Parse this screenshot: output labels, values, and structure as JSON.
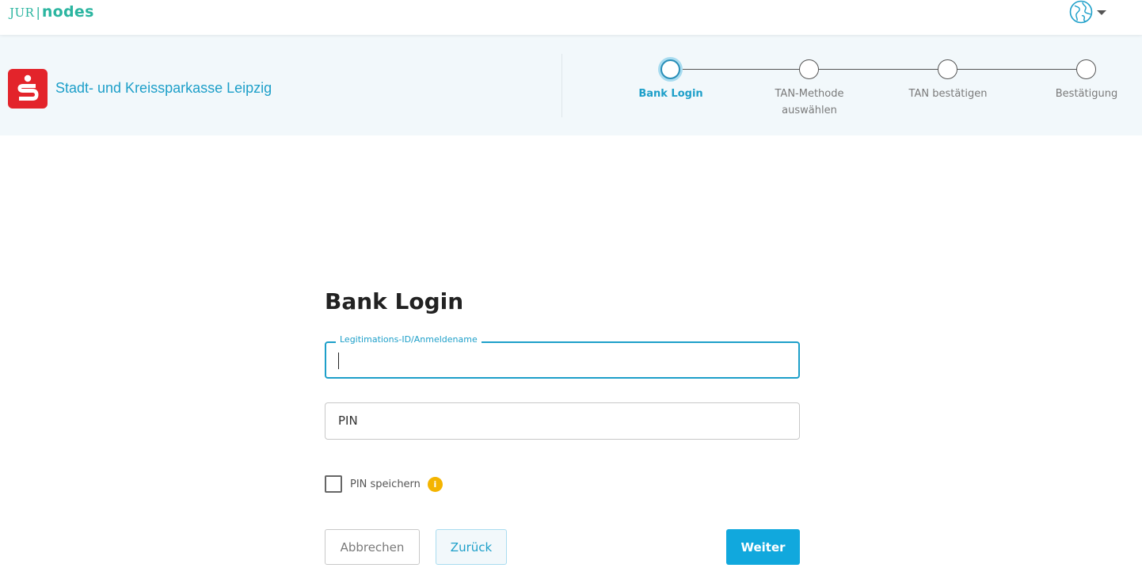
{
  "header": {
    "logo_jur": "JUR",
    "logo_sep": "|",
    "logo_nodes": "nodes"
  },
  "bank": {
    "name": "Stadt- und Kreissparkasse Leipzig"
  },
  "stepper": {
    "steps": [
      {
        "line1": "Bank Login",
        "line2": ""
      },
      {
        "line1": "TAN-Methode",
        "line2": "auswählen"
      },
      {
        "line1": "TAN bestätigen",
        "line2": ""
      },
      {
        "line1": "Bestätigung",
        "line2": ""
      }
    ],
    "active_index": 0
  },
  "form": {
    "title": "Bank Login",
    "username_label": "Legitimations-ID/Anmeldename",
    "username_value": "",
    "pin_placeholder": "PIN",
    "save_pin_label": "PIN speichern",
    "save_pin_checked": false,
    "info_glyph": "i"
  },
  "buttons": {
    "cancel": "Abbrechen",
    "back": "Zurück",
    "next": "Weiter"
  },
  "colors": {
    "accent": "#1d9fc9",
    "primary_button": "#11a8dd",
    "bank_red": "#e3242b",
    "info_yellow": "#f4b400",
    "brand_teal": "#2bb5a0"
  },
  "icons": {
    "language": "globe-icon",
    "language_caret": "chevron-down-icon",
    "bank_logo": "sparkasse-logo",
    "info": "info-icon"
  }
}
